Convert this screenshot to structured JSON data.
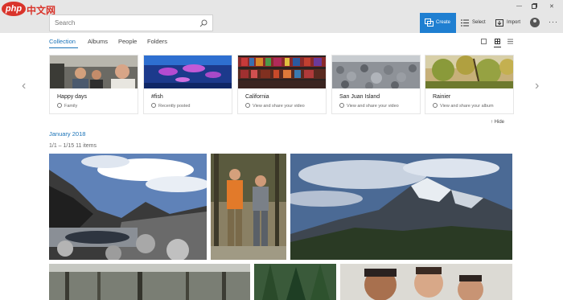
{
  "watermark": {
    "badge": "php",
    "text": "中文网"
  },
  "search": {
    "placeholder": "Search"
  },
  "commands": {
    "create": "Create",
    "select": "Select",
    "import": "Import"
  },
  "tabs": [
    "Collection",
    "Albums",
    "People",
    "Folders"
  ],
  "albums": [
    {
      "title": "Happy days",
      "subtitle": "Family"
    },
    {
      "title": "#fish",
      "subtitle": "Recently posted"
    },
    {
      "title": "California",
      "subtitle": "View and share your video"
    },
    {
      "title": "San Juan Island",
      "subtitle": "View and share your video"
    },
    {
      "title": "Rainier",
      "subtitle": "View and share your album"
    }
  ],
  "hide_label": "Hide",
  "section": {
    "date": "January 2018",
    "range": "1/1 – 1/15   11 items"
  },
  "colors": {
    "accent": "#1f7fd1",
    "link": "#1a73b8",
    "watermark_red": "#d9342b"
  },
  "icons": [
    "search-icon",
    "create-icon",
    "select-icon",
    "import-icon",
    "account-avatar-icon",
    "more-icon",
    "minimize-icon",
    "maximize-icon",
    "close-icon",
    "chevron-left-icon",
    "chevron-right-icon",
    "hide-arrow-icon"
  ]
}
